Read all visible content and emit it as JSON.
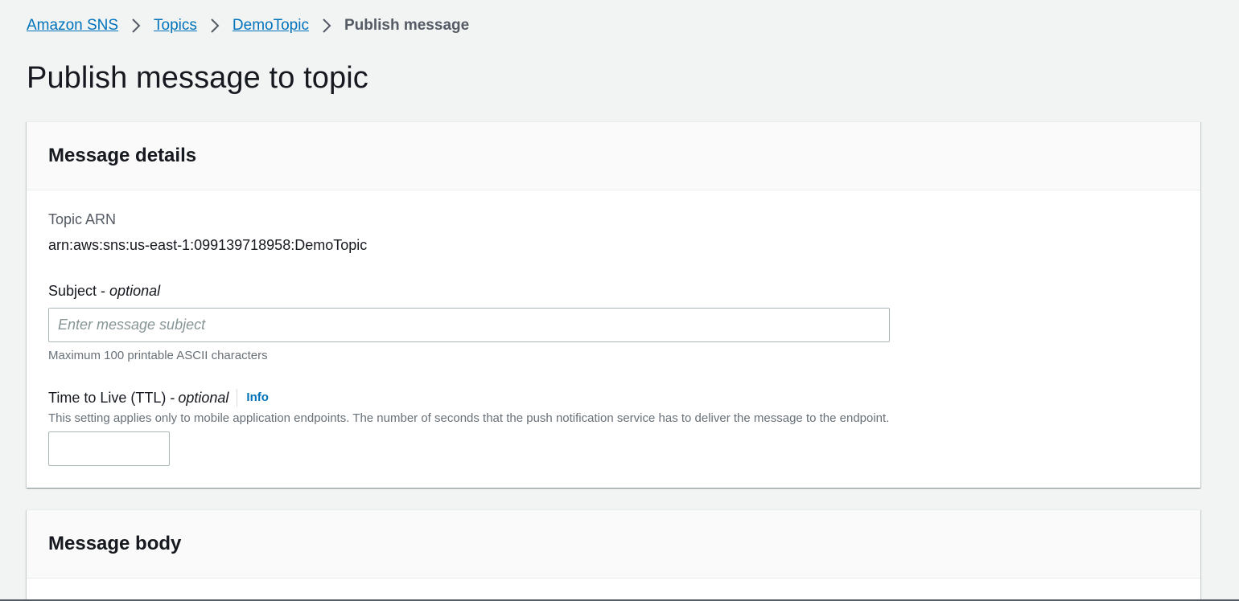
{
  "breadcrumb": {
    "items": [
      {
        "label": "Amazon SNS"
      },
      {
        "label": "Topics"
      },
      {
        "label": "DemoTopic"
      }
    ],
    "current": "Publish message"
  },
  "page": {
    "title": "Publish message to topic"
  },
  "message_details": {
    "heading": "Message details",
    "topic_arn_label": "Topic ARN",
    "topic_arn_value": "arn:aws:sns:us-east-1:099139718958:DemoTopic",
    "subject_label": "Subject - ",
    "subject_optional": "optional",
    "subject_placeholder": "Enter message subject",
    "subject_value": "",
    "subject_hint": "Maximum 100 printable ASCII characters",
    "ttl_label": "Time to Live (TTL) - ",
    "ttl_optional": "optional",
    "ttl_info": "Info",
    "ttl_description": "This setting applies only to mobile application endpoints. The number of seconds that the push notification service has to deliver the message to the endpoint.",
    "ttl_value": ""
  },
  "message_body": {
    "heading": "Message body"
  },
  "icons": {
    "breadcrumb_separator": "chevron-right-icon"
  },
  "colors": {
    "link": "#0073bb",
    "background": "#f2f3f3",
    "text": "#16191f"
  }
}
